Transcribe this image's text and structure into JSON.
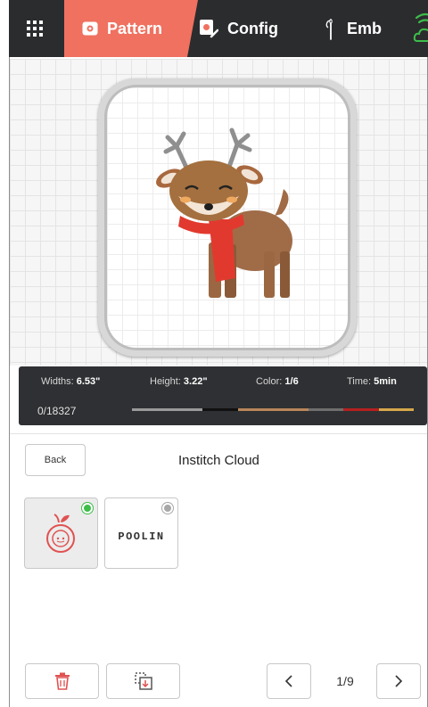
{
  "topbar": {
    "tabs": [
      {
        "label": "Pattern",
        "icon": "pattern-icon",
        "active": true
      },
      {
        "label": "Config",
        "icon": "config-icon",
        "active": false
      },
      {
        "label": "Emb",
        "icon": "needle-icon",
        "active": false
      }
    ],
    "accent_color": "#f07160",
    "bar_color": "#2b2c2e",
    "wifi_color": "#3dbd4a"
  },
  "pattern_info": {
    "width_label": "Widths:",
    "width_value": "6.53\"",
    "height_label": "Height:",
    "height_value": "3.22\"",
    "color_label": "Color:",
    "color_value": "1/6",
    "time_label": "Time:",
    "time_value": "5min",
    "stitch_progress": "0/18327",
    "thread_colors": [
      "#9a9a9a",
      "#9a9a9a",
      "#111111",
      "#b9855a",
      "#b9855a",
      "#6e6e6e",
      "#b52020",
      "#d7a84a"
    ]
  },
  "cloud": {
    "back_label": "Back",
    "title": "Institch Cloud",
    "items": [
      {
        "name": "apple-design",
        "selected": true,
        "status_color": "#3dbd4a"
      },
      {
        "name": "poolin-design",
        "text": "POOLIN",
        "selected": false,
        "status_color": "#a8a8a8"
      }
    ]
  },
  "pagination": {
    "page": "1/9"
  }
}
